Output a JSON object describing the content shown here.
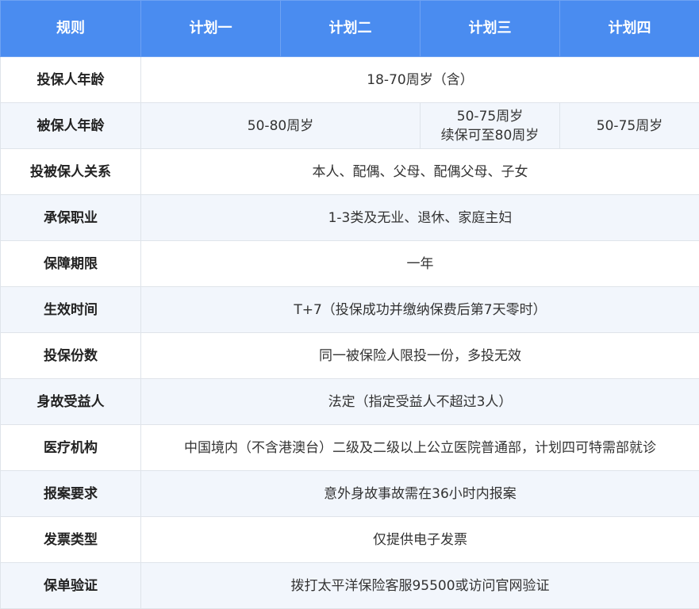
{
  "header": {
    "rule": "规则",
    "plans": [
      "计划一",
      "计划二",
      "计划三",
      "计划四"
    ]
  },
  "rows": [
    {
      "rule": "投保人年龄",
      "value": "18-70周岁（含）"
    },
    {
      "rule": "被保人年龄",
      "plan12": "50-80周岁",
      "plan3_line1": "50-75周岁",
      "plan3_line2": "续保可至80周岁",
      "plan4": "50-75周岁"
    },
    {
      "rule": "投被保人关系",
      "value": "本人、配偶、父母、配偶父母、子女"
    },
    {
      "rule": "承保职业",
      "value": "1-3类及无业、退休、家庭主妇"
    },
    {
      "rule": "保障期限",
      "value": "一年"
    },
    {
      "rule": "生效时间",
      "value": "T+7（投保成功并缴纳保费后第7天零时）"
    },
    {
      "rule": "投保份数",
      "value": "同一被保险人限投一份，多投无效"
    },
    {
      "rule": "身故受益人",
      "value": "法定（指定受益人不超过3人）"
    },
    {
      "rule": "医疗机构",
      "value": "中国境内（不含港澳台）二级及二级以上公立医院普通部，计划四可特需部就诊"
    },
    {
      "rule": "报案要求",
      "value": "意外身故事故需在36小时内报案"
    },
    {
      "rule": "发票类型",
      "value": "仅提供电子发票"
    },
    {
      "rule": "保单验证",
      "value": "拨打太平洋保险客服95500或访问官网验证"
    }
  ]
}
